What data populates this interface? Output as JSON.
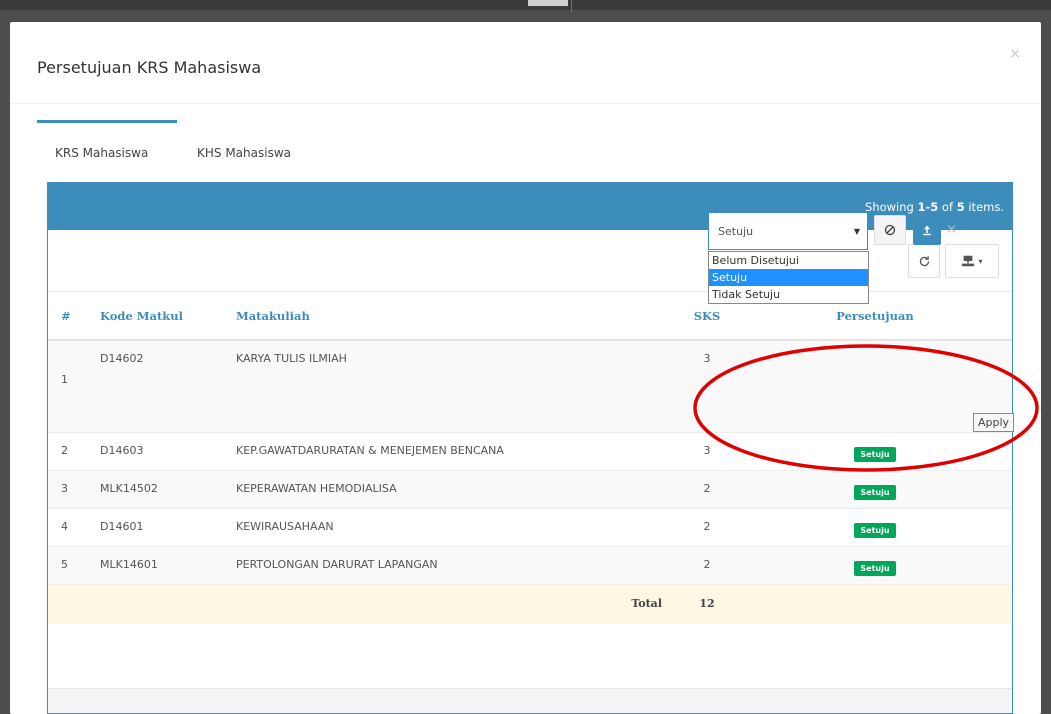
{
  "modal": {
    "title": "Persetujuan KRS Mahasiswa",
    "close_glyph": "×"
  },
  "tabs": [
    {
      "label": "KRS Mahasiswa",
      "active": true
    },
    {
      "label": "KHS Mahasiswa",
      "active": false
    }
  ],
  "grid": {
    "summary": "Showing 1-5 of 5 items.",
    "headers": {
      "num": "#",
      "kode": "Kode Matkul",
      "mk": "Matakuliah",
      "sks": "SKS",
      "per": "Persetujuan"
    },
    "rows": [
      {
        "num": "1",
        "kode": "D14602",
        "mk": "KARYA TULIS ILMIAH",
        "sks": "3",
        "status": ""
      },
      {
        "num": "2",
        "kode": "D14603",
        "mk": "KEP.GAWATDARURATAN & MENEJEMEN BENCANA",
        "sks": "3",
        "status": "Setuju"
      },
      {
        "num": "3",
        "kode": "MLK14502",
        "mk": "KEPERAWATAN HEMODIALISA",
        "sks": "2",
        "status": "Setuju"
      },
      {
        "num": "4",
        "kode": "D14601",
        "mk": "KEWIRAUSAHAAN",
        "sks": "2",
        "status": "Setuju"
      },
      {
        "num": "5",
        "kode": "MLK14601",
        "mk": "PERTOLONGAN DARURAT LAPANGAN",
        "sks": "2",
        "status": "Setuju"
      }
    ],
    "total_label": "Total",
    "total_value": "12"
  },
  "editor": {
    "selected_value": "Setuju",
    "options": [
      "Belum Disetujui",
      "Setuju",
      "Tidak Setuju"
    ],
    "selected_index": 1,
    "tooltip": "Apply"
  },
  "colors": {
    "primary": "#3c8dbc",
    "success": "#00a65a",
    "annotation": "#e00000",
    "total_bg": "#fcf8e3"
  },
  "icons": {
    "refresh": "refresh-icon",
    "export": "export-icon",
    "reset": "ban-icon",
    "apply": "upload-icon",
    "dropdown": "caret-down-icon"
  }
}
